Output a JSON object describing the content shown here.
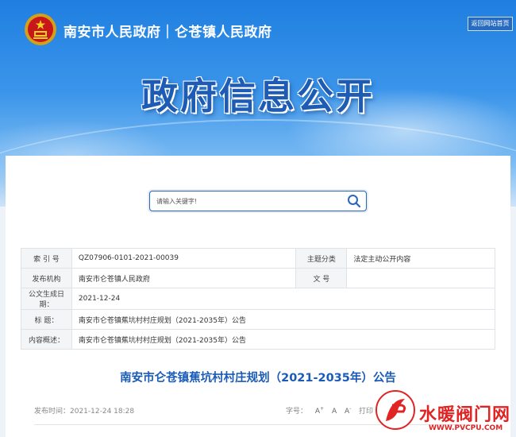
{
  "header": {
    "site_name": "南安市人民政府｜仑苍镇人民政府",
    "home_link": "返回网站首页",
    "banner_title": "政府信息公开"
  },
  "search": {
    "placeholder": "请输入关键字!"
  },
  "meta": {
    "index_label": "索 引 号",
    "index_value": "QZ07906-0101-2021-00039",
    "topic_label": "主题分类",
    "topic_value": "法定主动公开内容",
    "publisher_label": "发布机构",
    "publisher_value": "南安市仑苍镇人民政府",
    "docno_label": "文 号",
    "docno_value": "",
    "date_label": "公文生成日期：",
    "date_value": "2021-12-24",
    "title_label": "标  题：",
    "title_value": "南安市仑苍镇蕉坑村村庄规划（2021-2035年）公告",
    "summary_label": "内容概述：",
    "summary_value": "南安市仑苍镇蕉坑村村庄规划（2021-2035年）公告"
  },
  "article": {
    "title": "南安市仑苍镇蕉坑村村庄规划（2021-2035年）公告",
    "published": "发布时间：2021-12-24 18:28",
    "font_size_label": "字号：",
    "font_sizes": [
      "A",
      "A",
      "A"
    ],
    "font_size_sups": [
      "+",
      "",
      "-"
    ],
    "print_label": "打印"
  },
  "watermark": {
    "text": "水暖阀门网",
    "url": "WWW.PVCPU.COM"
  },
  "colors": {
    "brand_blue": "#1a5bb8",
    "watermark_red": "#e02424"
  }
}
